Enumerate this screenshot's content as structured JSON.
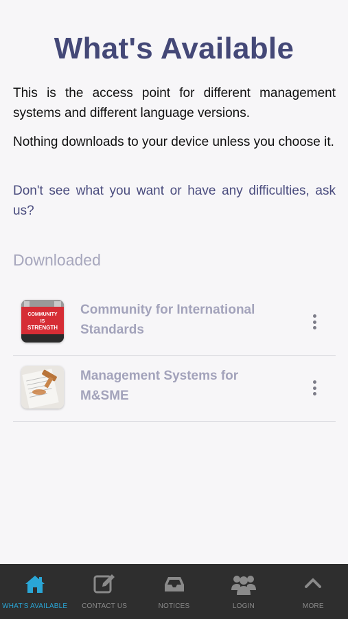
{
  "page": {
    "title": "What's Available",
    "paragraphs": [
      "This is the access point for different management systems and different language versions.",
      "Nothing downloads to your device unless you choose it.",
      "Don't see what you want or have any difficulties, ask us?"
    ]
  },
  "downloaded": {
    "heading": "Downloaded",
    "items": [
      {
        "title": "Community for International Standards",
        "thumb_text": [
          "COMMUNITY",
          "IS",
          "STRENGTH"
        ]
      },
      {
        "title": "Management Systems for M&SME"
      }
    ]
  },
  "tabbar": {
    "tabs": [
      {
        "label": "WHAT'S AVAILABLE",
        "icon": "home-icon"
      },
      {
        "label": "CONTACT US",
        "icon": "edit-icon"
      },
      {
        "label": "NOTICES",
        "icon": "inbox-icon"
      },
      {
        "label": "LOGIN",
        "icon": "users-icon"
      },
      {
        "label": "MORE",
        "icon": "chevron-up-icon"
      }
    ]
  },
  "colors": {
    "title": "#444877",
    "link_text": "#4a4c7e",
    "muted": "#a3a3bb",
    "tab_active": "#2aa6d6",
    "tabbar_bg": "#2e2e2e"
  }
}
